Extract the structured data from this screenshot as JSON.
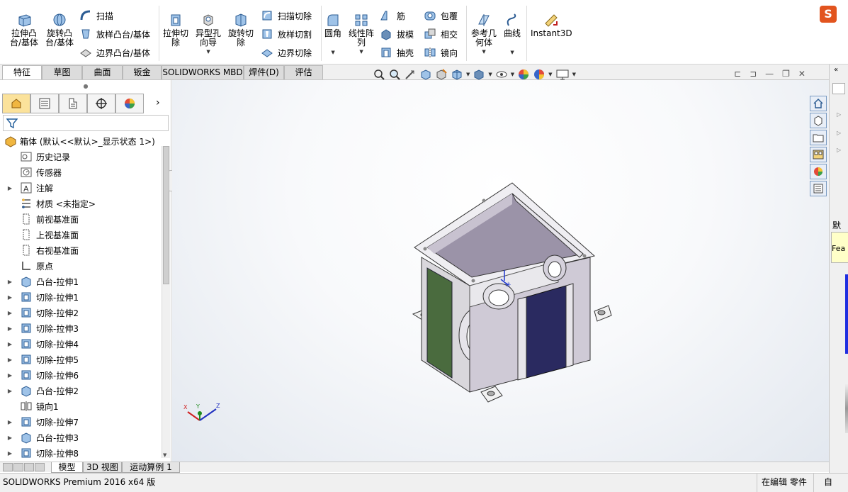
{
  "ribbon": {
    "big_buttons": [
      {
        "label_line1": "拉伸凸",
        "label_line2": "台/基体"
      },
      {
        "label_line1": "旋转凸",
        "label_line2": "台/基体"
      },
      {
        "label_line1": "拉伸切",
        "label_line2": "除"
      },
      {
        "label_line1": "异型孔",
        "label_line2": "向导"
      },
      {
        "label_line1": "旋转切",
        "label_line2": "除"
      },
      {
        "label_line1": "圆角",
        "label_line2": ""
      },
      {
        "label_line1": "线性阵",
        "label_line2": "列"
      },
      {
        "label_line1": "参考几",
        "label_line2": "何体"
      },
      {
        "label_line1": "曲线",
        "label_line2": ""
      },
      {
        "label_line1": "Instant3D",
        "label_line2": ""
      }
    ],
    "small_buttons": [
      "扫描",
      "放样凸台/基体",
      "边界凸台/基体",
      "扫描切除",
      "放样切割",
      "边界切除",
      "筋",
      "拔模",
      "抽壳",
      "包覆",
      "相交",
      "镜向"
    ]
  },
  "command_tabs": [
    "特征",
    "草图",
    "曲面",
    "钣金",
    "SOLIDWORKS MBD",
    "焊件(D)",
    "评估"
  ],
  "feature_tree": {
    "root": "箱体 (默认<<默认>_显示状态 1>)",
    "items": [
      {
        "label": "历史记录",
        "expand": false,
        "icon": "history-icon"
      },
      {
        "label": "传感器",
        "expand": false,
        "icon": "sensor-icon"
      },
      {
        "label": "注解",
        "expand": true,
        "icon": "annotation-icon"
      },
      {
        "label": "材质 <未指定>",
        "expand": false,
        "icon": "material-icon"
      },
      {
        "label": "前视基准面",
        "expand": false,
        "icon": "plane-icon"
      },
      {
        "label": "上视基准面",
        "expand": false,
        "icon": "plane-icon"
      },
      {
        "label": "右视基准面",
        "expand": false,
        "icon": "plane-icon"
      },
      {
        "label": "原点",
        "expand": false,
        "icon": "origin-icon"
      },
      {
        "label": "凸台-拉伸1",
        "expand": true,
        "icon": "boss-extrude-icon"
      },
      {
        "label": "切除-拉伸1",
        "expand": true,
        "icon": "cut-extrude-icon"
      },
      {
        "label": "切除-拉伸2",
        "expand": true,
        "icon": "cut-extrude-icon"
      },
      {
        "label": "切除-拉伸3",
        "expand": true,
        "icon": "cut-extrude-icon"
      },
      {
        "label": "切除-拉伸4",
        "expand": true,
        "icon": "cut-extrude-icon"
      },
      {
        "label": "切除-拉伸5",
        "expand": true,
        "icon": "cut-extrude-icon"
      },
      {
        "label": "切除-拉伸6",
        "expand": true,
        "icon": "cut-extrude-icon"
      },
      {
        "label": "凸台-拉伸2",
        "expand": true,
        "icon": "boss-extrude-icon"
      },
      {
        "label": "镜向1",
        "expand": false,
        "icon": "mirror-icon"
      },
      {
        "label": "切除-拉伸7",
        "expand": true,
        "icon": "cut-extrude-icon"
      },
      {
        "label": "凸台-拉伸3",
        "expand": true,
        "icon": "boss-extrude-icon"
      },
      {
        "label": "切除-拉伸8",
        "expand": true,
        "icon": "cut-extrude-icon"
      }
    ]
  },
  "bottom_tabs": [
    "模型",
    "3D 视图",
    "运动算例 1"
  ],
  "status": {
    "left": "SOLIDWORKS Premium 2016 x64 版",
    "mode": "在编辑 零件",
    "extra": "自"
  },
  "triad": {
    "x": "X",
    "y": "Y",
    "z": "Z"
  },
  "right_pane": {
    "label1": "默认",
    "label2": "Fea"
  },
  "colors": {
    "accent": "#e2541e",
    "selection": "#fbe29b",
    "model_face": "#d8d4dc",
    "model_dark": "#2a2a60",
    "model_green": "#4a6b3e"
  }
}
